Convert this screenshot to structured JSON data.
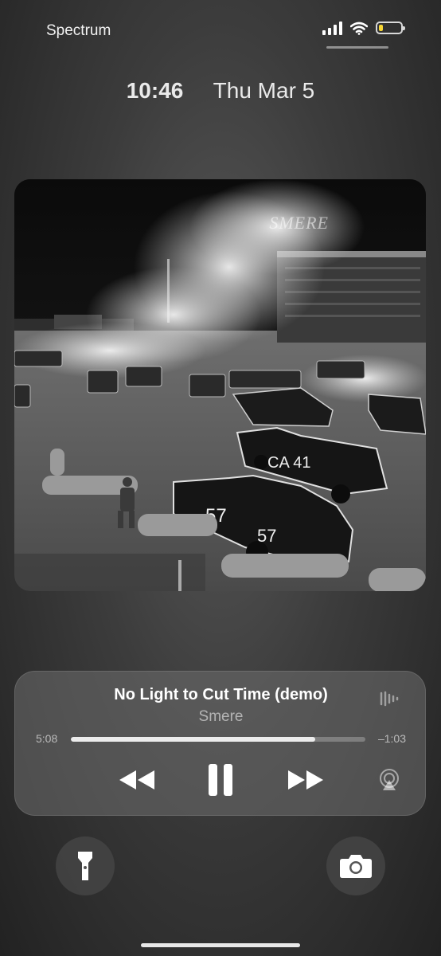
{
  "status_bar": {
    "carrier": "Spectrum",
    "signal_bars": 4,
    "wifi": "wifi-icon",
    "battery_level": 0.2,
    "battery_color": "#f6d634"
  },
  "lock_screen": {
    "time": "10:46",
    "date": "Thu Mar 5"
  },
  "artwork": {
    "watermark": "SMERE"
  },
  "now_playing": {
    "title": "No Light to Cut Time (demo)",
    "artist": "Smere",
    "elapsed": "5:08",
    "remaining": "–1:03",
    "progress": 0.83,
    "controls": [
      "rewind-icon",
      "pause-icon",
      "fast-forward-icon",
      "airplay-icon"
    ]
  },
  "quick_actions": [
    "flashlight-icon",
    "camera-icon"
  ]
}
